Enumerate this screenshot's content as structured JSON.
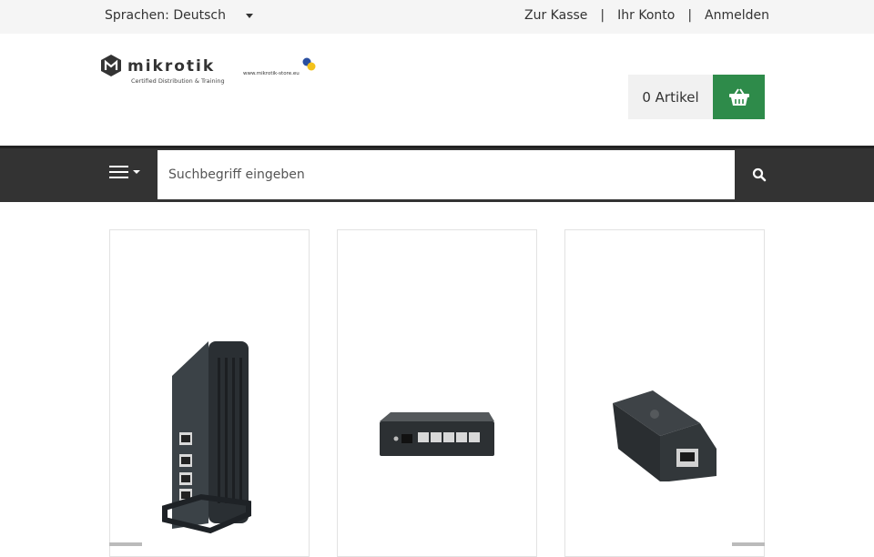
{
  "topbar": {
    "language_label": "Sprachen: Deutsch",
    "links": [
      "Zur Kasse",
      "Ihr Konto",
      "Anmelden"
    ],
    "separator": "|"
  },
  "logo": {
    "brand": "mikrotik",
    "tagline": "Certified Distribution & Training",
    "store_url": "www.mikrotik-store.eu"
  },
  "cart": {
    "count_label": "0 Artikel",
    "button_color": "#2e8b4a"
  },
  "navbar": {
    "search_placeholder": "Suchbegriff eingeben",
    "menu_icon": "hamburger-icon",
    "search_icon": "search-icon"
  },
  "products": [
    {
      "image": "tower-router-image"
    },
    {
      "image": "desktop-switch-image"
    },
    {
      "image": "poe-adapter-image"
    }
  ]
}
